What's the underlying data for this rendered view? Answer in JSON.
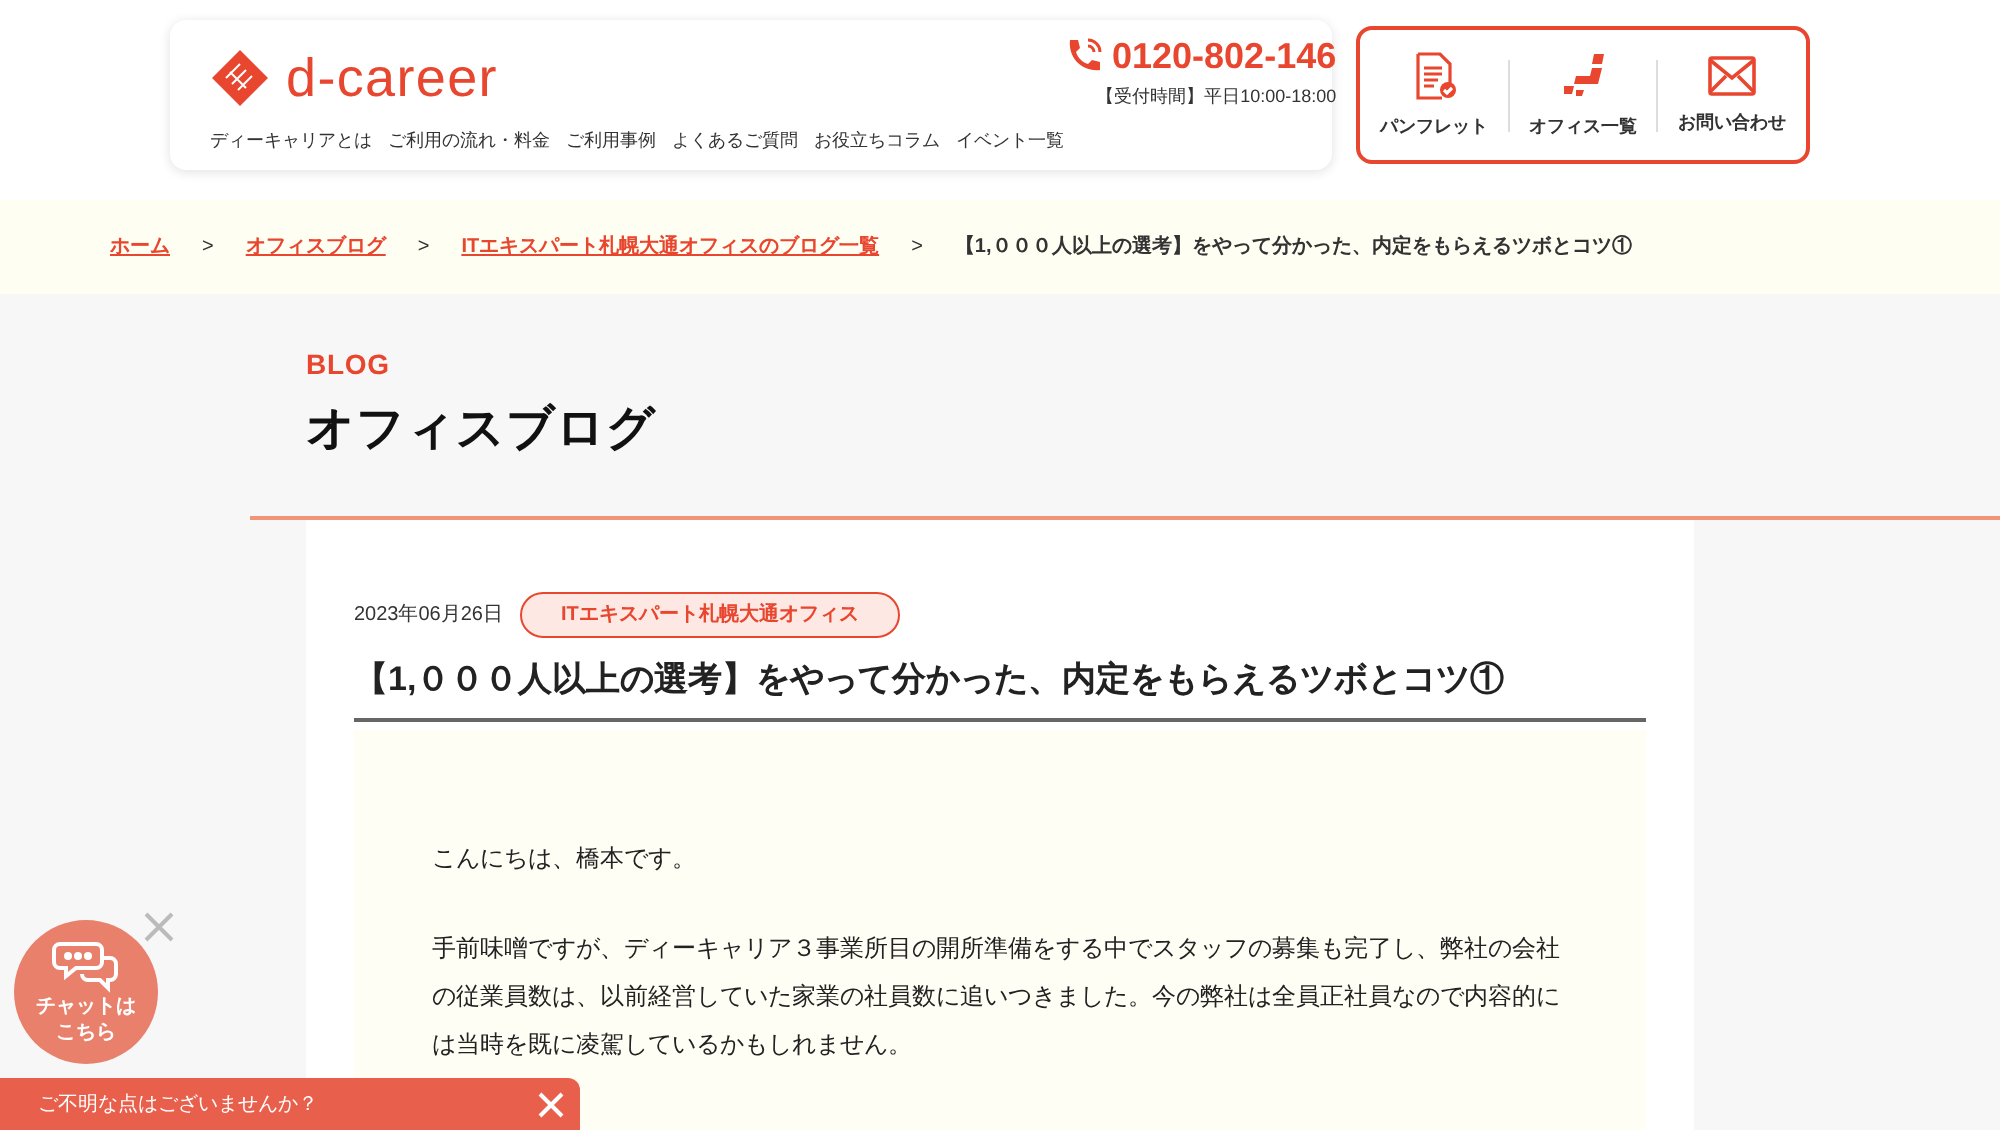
{
  "header": {
    "logo": "d-career",
    "phone": "0120-802-146",
    "hours": "【受付時間】平日10:00-18:00",
    "nav": [
      "ディーキャリアとは",
      "ご利用の流れ・料金",
      "ご利用事例",
      "よくあるご質問",
      "お役立ちコラム",
      "イベント一覧"
    ],
    "actions": [
      {
        "kind": "document",
        "label": "パンフレット"
      },
      {
        "kind": "map",
        "label": "オフィス一覧"
      },
      {
        "kind": "mail",
        "label": "お問い合わせ"
      }
    ]
  },
  "breadcrumb": {
    "links": [
      "ホーム",
      "オフィスブログ",
      "ITエキスパート札幌大通オフィスのブログ一覧"
    ],
    "separator": ">",
    "current": "【1,０００人以上の選考】をやって分かった、内定をもらえるツボとコツ①"
  },
  "section": {
    "eyebrow": "BLOG",
    "title": "オフィスブログ"
  },
  "article": {
    "date": "2023年06月26日",
    "tag": "ITエキスパート札幌大通オフィス",
    "title": "【1,０００人以上の選考】をやって分かった、内定をもらえるツボとコツ①",
    "paragraphs": [
      "こんにちは、橋本です。",
      "手前味噌ですが、ディーキャリア３事業所目の開所準備をする中でスタッフの募集も完了し、弊社の会社の従業員数は、以前経営していた家業の社員数に追いつきました。今の弊社は全員正社員なので内容的には当時を既に凌駕しているかもしれません。"
    ]
  },
  "chat": {
    "label": "チャットはこちら",
    "bar": "ご不明な点はございませんか？"
  }
}
